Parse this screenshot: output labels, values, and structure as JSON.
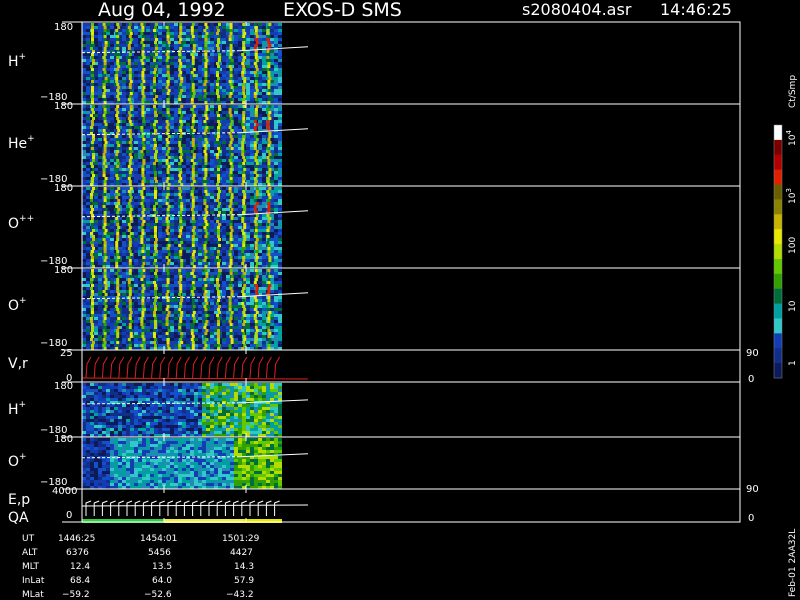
{
  "header": {
    "date": "Aug 04, 1992",
    "instrument": "EXOS-D SMS",
    "file": "s2080404.asr",
    "time": "14:46:25"
  },
  "colorbar": {
    "title": "Ct/Smp",
    "tick_labels": [
      {
        "text": "10",
        "sup": "4",
        "value": 10000
      },
      {
        "text": "10",
        "sup": "3",
        "value": 1000
      },
      {
        "text": "100",
        "sup": "",
        "value": 100
      },
      {
        "text": "10",
        "sup": "",
        "value": 10
      },
      {
        "text": "1",
        "sup": "",
        "value": 1
      }
    ],
    "colors": [
      "#ffffff",
      "#7a0000",
      "#b00000",
      "#e02000",
      "#6a5e00",
      "#8c8200",
      "#c8b400",
      "#e8e800",
      "#b4dc00",
      "#64c800",
      "#32a000",
      "#006e3c",
      "#00a0a0",
      "#32c8c8",
      "#143cb4",
      "#102e8a",
      "#0c1c5a"
    ]
  },
  "panels": [
    {
      "name": "h-plus",
      "label": "H",
      "sup": "+",
      "ymax": "180",
      "ymin": "−180"
    },
    {
      "name": "he-plus",
      "label": "He",
      "sup": "+",
      "ymax": "180",
      "ymin": "−180"
    },
    {
      "name": "o-plusplus",
      "label": "O",
      "sup": "++",
      "ymax": "180",
      "ymin": "−180"
    },
    {
      "name": "o-plus",
      "label": "O",
      "sup": "+",
      "ymax": "180",
      "ymin": "−180"
    },
    {
      "name": "vr",
      "label": "V,r",
      "sup": "",
      "ymax": "25",
      "ymin": "0",
      "right_max": "90",
      "right_min": "0"
    },
    {
      "name": "h-plus-2",
      "label": "H",
      "sup": "+",
      "ymax": "180",
      "ymin": "−180"
    },
    {
      "name": "o-plus-2",
      "label": "O",
      "sup": "+",
      "ymax": "180",
      "ymin": "−180"
    },
    {
      "name": "ep-qa",
      "label": "E,p",
      "label2": "QA",
      "sup": "",
      "ymax": "4000",
      "ymin": "0",
      "right_max": "90",
      "right_min": "0"
    }
  ],
  "ephemeris": {
    "rows": [
      {
        "label": "UT",
        "values": [
          "1446:25",
          "1454:01",
          "1501:29"
        ]
      },
      {
        "label": "ALT",
        "values": [
          "6376",
          "5456",
          "4427"
        ]
      },
      {
        "label": "MLT",
        "values": [
          "12.4",
          "13.5",
          "14.3"
        ]
      },
      {
        "label": "InLat",
        "values": [
          "68.4",
          "64.0",
          "57.9"
        ]
      },
      {
        "label": "MLat",
        "values": [
          "−59.2",
          "−52.6",
          "−43.2"
        ]
      }
    ]
  },
  "footer": "Feb-01 2AA32L",
  "chart_data": {
    "type": "heatmap",
    "x_ticks_ut": [
      "1446:25",
      "1454:01",
      "1501:29"
    ],
    "panels": [
      {
        "label": "H+",
        "y_range": [
          -180,
          180
        ]
      },
      {
        "label": "He+",
        "y_range": [
          -180,
          180
        ]
      },
      {
        "label": "O++",
        "y_range": [
          -180,
          180
        ]
      },
      {
        "label": "O+",
        "y_range": [
          -180,
          180
        ]
      },
      {
        "label": "V,r",
        "y_range": [
          0,
          25
        ],
        "right_range": [
          0,
          90
        ]
      },
      {
        "label": "H+",
        "y_range": [
          -180,
          180
        ]
      },
      {
        "label": "O+",
        "y_range": [
          -180,
          180
        ]
      },
      {
        "label": "E,p QA",
        "y_range": [
          0,
          4000
        ],
        "right_range": [
          0,
          90
        ]
      }
    ],
    "colorbar_scale": "log",
    "colorbar_range": [
      1,
      10000
    ],
    "colorbar_unit": "Ct/Smp"
  }
}
